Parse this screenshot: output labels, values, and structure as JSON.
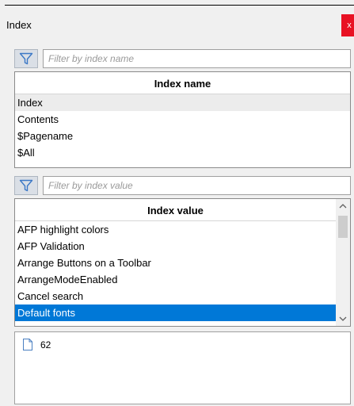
{
  "window": {
    "title": "Index",
    "close_glyph": "x"
  },
  "name_filter": {
    "placeholder": "Filter by index name",
    "value": "",
    "icon": "filter-icon"
  },
  "name_list": {
    "header": "Index name",
    "items": [
      "Index",
      "Contents",
      "$Pagename",
      "$All"
    ],
    "highlighted_index": 0
  },
  "value_filter": {
    "placeholder": "Filter by index value",
    "value": "",
    "icon": "filter-icon"
  },
  "value_list": {
    "header": "Index value",
    "items": [
      "AFP highlight colors",
      "AFP Validation",
      "Arrange Buttons on a Toolbar",
      "ArrangeModeEnabled",
      "Cancel search",
      "Default fonts"
    ],
    "selected_index": 5,
    "selected_color": "#0078d7"
  },
  "results": {
    "items": [
      {
        "icon": "page-icon",
        "label": "62"
      }
    ]
  },
  "colors": {
    "close_button": "#e81123",
    "accent": "#0078d7"
  }
}
